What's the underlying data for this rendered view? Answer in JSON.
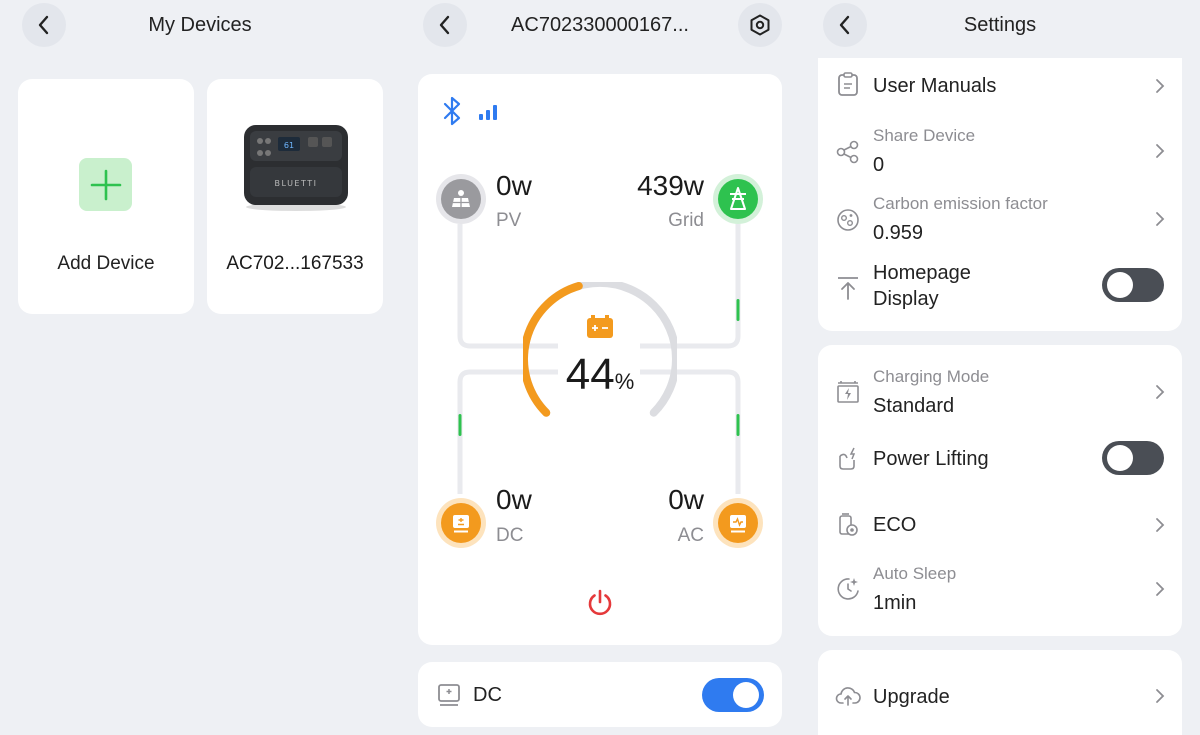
{
  "left_panel": {
    "title": "My Devices",
    "add_device_label": "Add Device",
    "device_name": "AC702...167533",
    "device_brand": "BLUETTI"
  },
  "middle_panel": {
    "title": "AC702330000167...",
    "battery_percent": "44",
    "battery_unit": "%",
    "battery_level": 0.44,
    "pv": {
      "value": "0w",
      "label": "PV"
    },
    "grid": {
      "value": "439w",
      "label": "Grid"
    },
    "dc": {
      "value": "0w",
      "label": "DC"
    },
    "ac": {
      "value": "0w",
      "label": "AC"
    },
    "dc_toggle_label": "DC",
    "dc_toggle_on": true
  },
  "right_panel": {
    "title": "Settings",
    "items": [
      {
        "label": "User Manuals"
      },
      {
        "label": "Share Device",
        "value": "0"
      },
      {
        "label": "Carbon emission factor",
        "value": "0.959"
      },
      {
        "label_line1": "Homepage",
        "label_line2": "Display",
        "toggle_on": false
      },
      {
        "label": "Charging Mode",
        "value": "Standard"
      },
      {
        "label": "Power Lifting",
        "toggle_on": false
      },
      {
        "label": "ECO"
      },
      {
        "label": "Auto Sleep",
        "value": "1min"
      },
      {
        "label": "Upgrade"
      }
    ]
  },
  "colors": {
    "accent_blue": "#2f7bf0",
    "battery_orange": "#f39a1e",
    "grid_green": "#2ec24f",
    "pv_gray": "#9a9a9e",
    "power_red": "#e5393b"
  }
}
